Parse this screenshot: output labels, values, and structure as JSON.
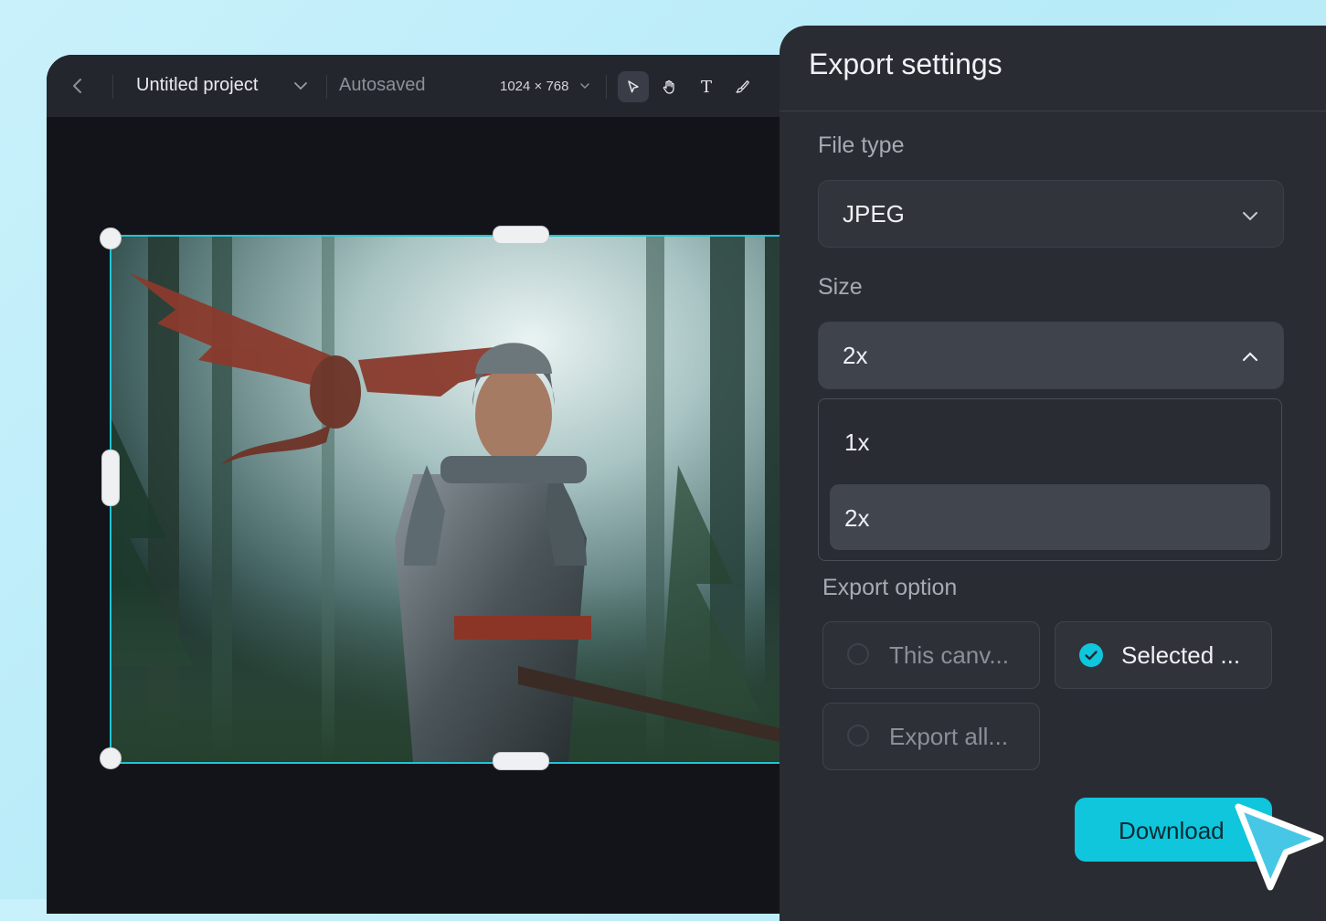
{
  "editor": {
    "project_title": "Untitled project",
    "save_status": "Autosaved",
    "canvas_size": "1024 × 768",
    "tools": [
      "select-tool",
      "hand-tool",
      "text-tool",
      "brush-tool"
    ],
    "text_tool_glyph": "T"
  },
  "export": {
    "title": "Export settings",
    "file_type": {
      "label": "File type",
      "value": "JPEG"
    },
    "size": {
      "label": "Size",
      "value": "2x",
      "options": [
        "1x",
        "2x"
      ],
      "selected_option": "2x"
    },
    "export_option": {
      "label": "Export option",
      "choices": [
        {
          "label": "This canv...",
          "checked": false
        },
        {
          "label": "Selected ...",
          "checked": true
        },
        {
          "label": "Export all...",
          "checked": false
        }
      ]
    },
    "download_label": "Download"
  },
  "colors": {
    "accent": "#0fc6dc",
    "selection": "#20c4d3",
    "panel": "#2a2c33",
    "editor_bg": "#131419"
  }
}
